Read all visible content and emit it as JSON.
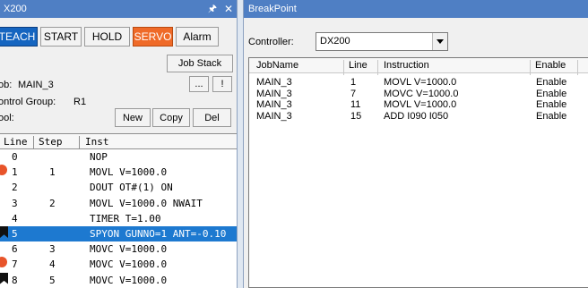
{
  "left_panel": {
    "title": "X200",
    "pin_icon": "pin-icon",
    "close_icon": "close-icon",
    "buttons": {
      "teach": "TEACH",
      "start": "START",
      "hold": "HOLD",
      "servo": "SERVO",
      "alarm": "Alarm"
    },
    "job_stack": "Job Stack",
    "job_label": "ob:",
    "job_value": "MAIN_3",
    "browse_btn": "...",
    "bang_btn": "!",
    "control_group_label": "ontrol Group:",
    "control_group_value": "R1",
    "tool_label": "ool:",
    "tool_buttons": {
      "new": "New",
      "copy": "Copy",
      "del": "Del"
    },
    "columns": {
      "line": "Line",
      "step": "Step",
      "inst": "Inst"
    },
    "rows": [
      {
        "line": "0",
        "step": "",
        "inst": "NOP",
        "marker": ""
      },
      {
        "line": "1",
        "step": "1",
        "inst": "MOVL V=1000.0",
        "marker": "breakpoint"
      },
      {
        "line": "2",
        "step": "",
        "inst": "DOUT OT#(1) ON",
        "marker": ""
      },
      {
        "line": "3",
        "step": "2",
        "inst": "MOVL V=1000.0 NWAIT",
        "marker": ""
      },
      {
        "line": "4",
        "step": "",
        "inst": "TIMER T=1.00",
        "marker": ""
      },
      {
        "line": "5",
        "step": "",
        "inst": "SPYON GUNNO=1 ANT=-0.10",
        "marker": "cursor",
        "selected": true
      },
      {
        "line": "6",
        "step": "3",
        "inst": "MOVC V=1000.0",
        "marker": ""
      },
      {
        "line": "7",
        "step": "4",
        "inst": "MOVC V=1000.0",
        "marker": "breakpoint"
      },
      {
        "line": "8",
        "step": "5",
        "inst": "MOVC V=1000.0",
        "marker": "cursor"
      }
    ]
  },
  "right_panel": {
    "title": "BreakPoint",
    "controller_label": "Controller:",
    "controller_value": "DX200",
    "columns": {
      "jobname": "JobName",
      "line": "Line",
      "instruction": "Instruction",
      "enable": "Enable"
    },
    "rows": [
      {
        "jobname": "MAIN_3",
        "line": "1",
        "instruction": "MOVL V=1000.0",
        "enable": "Enable"
      },
      {
        "jobname": "MAIN_3",
        "line": "7",
        "instruction": "MOVC V=1000.0",
        "enable": "Enable"
      },
      {
        "jobname": "MAIN_3",
        "line": "11",
        "instruction": "MOVL V=1000.0",
        "enable": "Enable"
      },
      {
        "jobname": "MAIN_3",
        "line": "15",
        "instruction": "ADD I090 I050",
        "enable": "Enable"
      }
    ]
  },
  "colors": {
    "titlebar": "#4f7fc4",
    "teach": "#1565c0",
    "servo": "#ef6a28",
    "selection": "#1d79d0",
    "breakpoint": "#e8542a"
  }
}
